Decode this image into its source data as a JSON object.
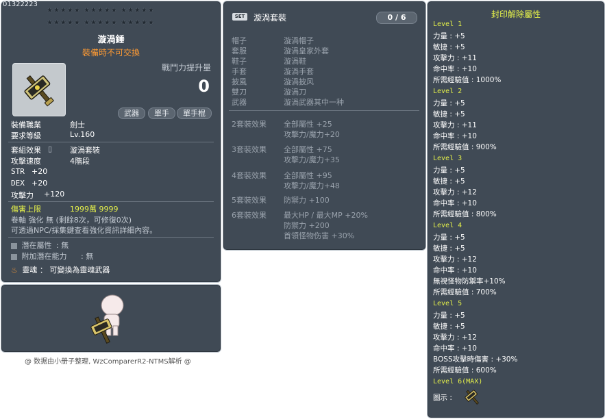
{
  "item": {
    "id": "01322223",
    "stars_row1": "★★★★★ ★★★★★ ★★★★★",
    "stars_row2": "★★★★★ ★★★★★ ★★★★★",
    "name": "漩渦錘",
    "untradable": "裝備時不可交換",
    "combat_label": "戰鬥力提升量",
    "combat_value": "0",
    "tags": [
      "武器",
      "單手",
      "單手棍"
    ],
    "job_label": "裝備職業",
    "job_value": "劍士",
    "req_label": "要求等級",
    "req_value": "Lv.160",
    "set_label": "套組效果",
    "set_value": "漩渦套裝",
    "speed_label": "攻擊速度",
    "speed_value": "4階段",
    "str_label": "STR",
    "str_value": "+20",
    "dex_label": "DEX",
    "dex_value": "+20",
    "atk_label": "攻擊力",
    "atk_value": "+120",
    "cap_label": "傷害上限",
    "cap_value": "1999萬 9999",
    "scroll_line": "卷軸 強化 無 (剩餘8次，可修復0次)",
    "npc_line": "可透過NPC/採集鍵查看強化資訊詳細內容。",
    "potential_label": "潛在屬性",
    "potential_value": ": 無",
    "addpot_label": "附加潛在能力",
    "addpot_value": ": 無",
    "soul_line": "靈魂 ： 可變換為靈魂武器"
  },
  "set": {
    "badge": "SET",
    "name": "漩渦套裝",
    "count": "0 / 6",
    "pieces": [
      {
        "slot": "帽子",
        "name": "漩渦帽子"
      },
      {
        "slot": "套服",
        "name": "漩渦皇家外套"
      },
      {
        "slot": "鞋子",
        "name": "漩渦鞋"
      },
      {
        "slot": "手套",
        "name": "漩渦手套"
      },
      {
        "slot": "披風",
        "name": "漩渦披风"
      },
      {
        "slot": "雙刀",
        "name": "漩渦刀"
      },
      {
        "slot": "武器",
        "name": "漩渦武器其中一种"
      }
    ],
    "effects": [
      {
        "label": "2套裝效果",
        "lines": [
          "全部屬性 +25",
          "攻擊力/魔力+20"
        ]
      },
      {
        "label": "3套裝效果",
        "lines": [
          "全部屬性 +75",
          "攻擊力/魔力+35"
        ]
      },
      {
        "label": "4套裝效果",
        "lines": [
          "全部屬性 +95",
          "攻擊力/魔力+48"
        ]
      },
      {
        "label": "5套裝效果",
        "lines": [
          "防禦力 +100"
        ]
      },
      {
        "label": "6套裝效果",
        "lines": [
          "最大HP / 最大MP +20%",
          "防禦力 +200",
          "首領怪物伤害 +30%"
        ]
      }
    ]
  },
  "credit": "@ 数据由小册子整理, WzComparerR2-NTMS解析 @",
  "seal": {
    "title": "封印解除屬性",
    "levels": [
      {
        "title": "Level 1",
        "lines": [
          "力量 : +5",
          "敏捷 : +5",
          "攻擊力 : +11",
          "命中率 : +10",
          "所需經驗值 : 1000%"
        ]
      },
      {
        "title": "Level 2",
        "lines": [
          "力量 : +5",
          "敏捷 : +5",
          "攻擊力 : +11",
          "命中率 : +10",
          "所需經驗值 : 900%"
        ]
      },
      {
        "title": "Level 3",
        "lines": [
          "力量 : +5",
          "敏捷 : +5",
          "攻擊力 : +12",
          "命中率 : +10",
          "所需經驗值 : 800%"
        ]
      },
      {
        "title": "Level 4",
        "lines": [
          "力量 : +5",
          "敏捷 : +5",
          "攻擊力 : +12",
          "命中率 : +10",
          "無視怪物防禦率+10%",
          "所需經驗值 : 700%"
        ]
      },
      {
        "title": "Level 5",
        "lines": [
          "力量 : +5",
          "敏捷 : +5",
          "攻擊力 : +12",
          "命中率 : +10",
          "BOSS攻擊時傷害 : +30%",
          "所需經驗值 : 600%"
        ]
      },
      {
        "title": "Level 6(MAX)",
        "lines": [
          "圖示 :"
        ]
      }
    ]
  }
}
